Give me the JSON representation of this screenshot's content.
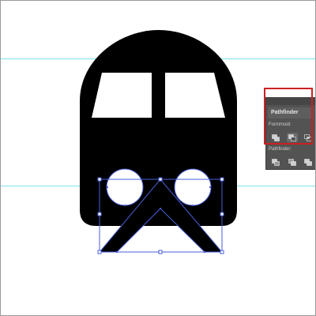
{
  "pathfinder_panel": {
    "title": "Pathfinder",
    "shape_modes_label": "Formmodi:",
    "pathfinders_label": "Pathfinder:",
    "shape_mode_buttons": [
      {
        "icon": "unite-icon"
      },
      {
        "icon": "minus-front-icon"
      },
      {
        "icon": "intersect-icon"
      }
    ],
    "pathfinder_buttons": [
      {
        "icon": "divide-icon"
      },
      {
        "icon": "trim-icon"
      },
      {
        "icon": "merge-icon"
      }
    ]
  },
  "colors": {
    "artwork_fill": "#000000",
    "selection_color": "#4a5fd8",
    "guide_color": "#7fe3e6",
    "panel_bg": "#535353",
    "highlight": "#cc2020"
  }
}
